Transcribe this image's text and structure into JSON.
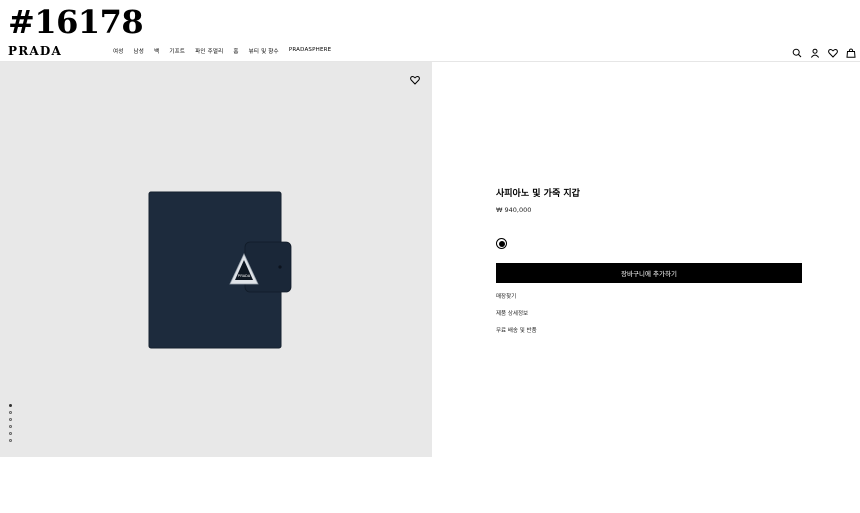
{
  "watermark": "#16178",
  "header": {
    "logo": "PRADA",
    "nav": [
      "여성",
      "남성",
      "백",
      "기프트",
      "파인 주얼리",
      "홈",
      "뷰티 및 향수",
      "PRADASPHERE"
    ],
    "icons": [
      "search-icon",
      "account-icon",
      "wishlist-icon",
      "bag-icon"
    ]
  },
  "product": {
    "title": "사피아노 및 가죽 지갑",
    "price": "₩ 940,000",
    "add_to_cart": "장바구니에 추가하기",
    "links": {
      "store_finder": "매장찾기",
      "details": "제품 상세정보",
      "shipping": "무료 배송 및 반품"
    },
    "colors": {
      "wallet": "#1d2b3d",
      "background": "#e8e8e8",
      "swatch": "#000000"
    }
  },
  "gallery": {
    "image_count": 6,
    "active_index": 0
  }
}
